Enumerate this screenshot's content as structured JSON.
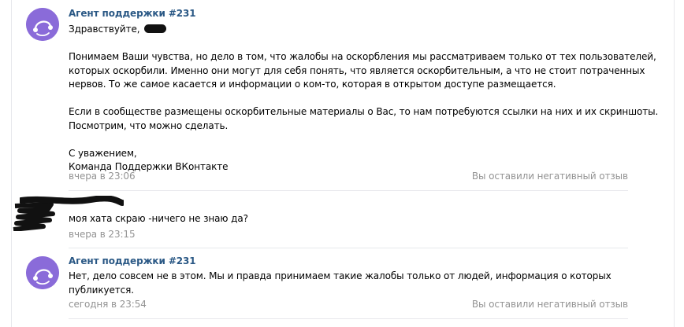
{
  "messages": [
    {
      "author": "Агент поддержки #231",
      "greeting": "Здравствуйте,",
      "lines": [
        "Понимаем Ваши чувства, но дело в том, что жалобы на оскорбления мы рассматриваем только от тех пользователей,",
        "которых оскорбили. Именно они могут для себя понять, что является оскорбительным, а что не стоит потраченных",
        "нервов. То же самое касается и информации о ком-то, которая в открытом доступе размещается.",
        "Если в сообществе размещены оскорбительные материалы о Вас, то нам потребуются ссылки на них и их скриншоты.",
        "Посмотрим, что можно сделать.",
        "С уважением,",
        "Команда Поддержки ВКонтакте"
      ],
      "time": "вчера в 23:06",
      "feedback": "Вы оставили негативный отзыв"
    },
    {
      "text": "моя хата скраю -ничего не знаю да?",
      "time": "вчера в 23:15"
    },
    {
      "author": "Агент поддержки #231",
      "lines": [
        "Нет, дело совсем не в этом. Мы и правда принимаем такие жалобы только от людей, информация о которых",
        "публикуется."
      ],
      "time": "сегодня в 23:54",
      "feedback": "Вы оставили негативный отзыв"
    }
  ],
  "icons": {
    "agent_avatar": "support-agent-avatar-icon"
  },
  "colors": {
    "author": "#2a5885",
    "meta": "#939393",
    "avatar": "#8a6bd9",
    "divider": "#e7e8ec"
  }
}
